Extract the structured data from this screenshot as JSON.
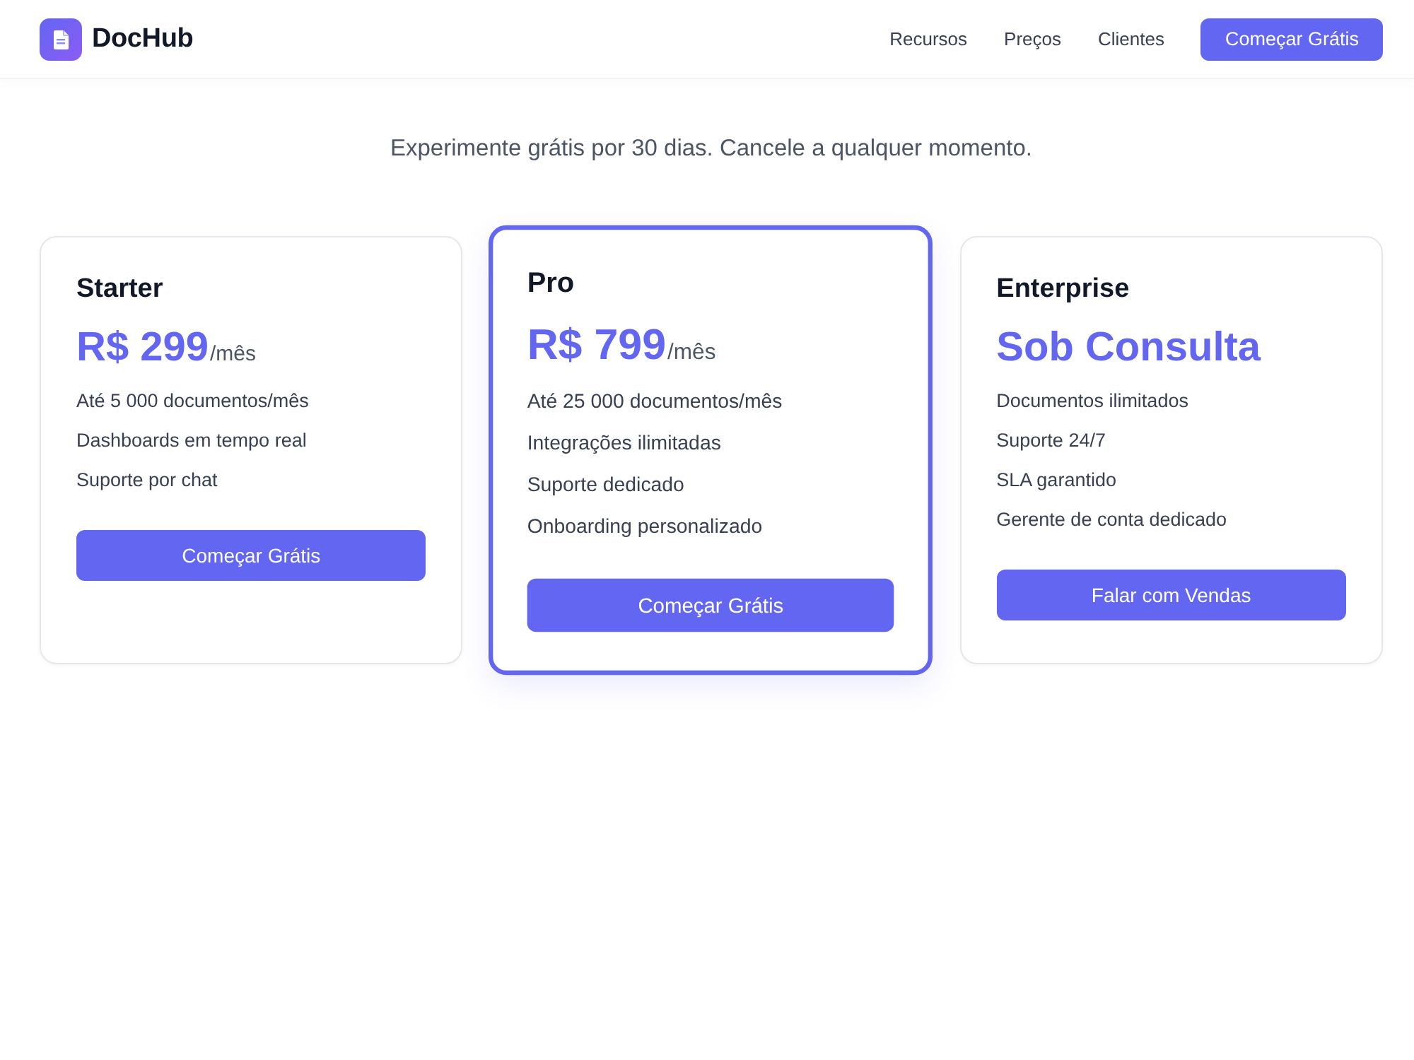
{
  "header": {
    "brand": "DocHub",
    "nav": [
      "Recursos",
      "Preços",
      "Clientes"
    ],
    "cta": "Começar Grátis"
  },
  "hero": {
    "subtitle": "Experimente grátis por 30 dias. Cancele a qualquer momento."
  },
  "plans": [
    {
      "name": "Starter",
      "price": "R$ 299",
      "period": "/mês",
      "featured": false,
      "features": [
        "Até 5 000 documentos/mês",
        "Dashboards em tempo real",
        "Suporte por chat"
      ],
      "button": "Começar Grátis"
    },
    {
      "name": "Pro",
      "price": "R$ 799",
      "period": "/mês",
      "featured": true,
      "features": [
        "Até 25 000 documentos/mês",
        "Integrações ilimitadas",
        "Suporte dedicado",
        "Onboarding personalizado"
      ],
      "button": "Começar Grátis"
    },
    {
      "name": "Enterprise",
      "price": "Sob Consulta",
      "featured": false,
      "features": [
        "Documentos ilimitados",
        "Suporte 24/7",
        "SLA garantido",
        "Gerente de conta dedicado"
      ],
      "button": "Falar com Vendas"
    }
  ]
}
